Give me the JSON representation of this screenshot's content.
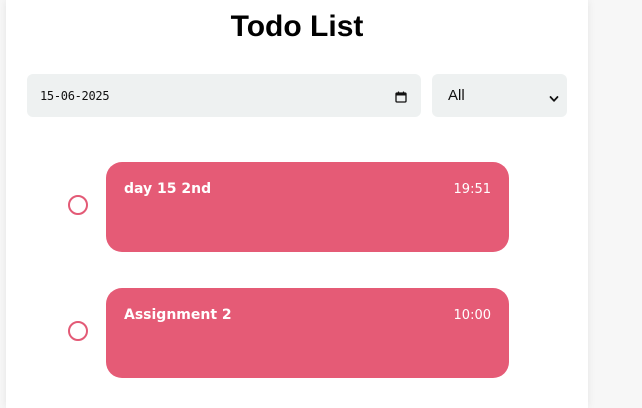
{
  "header": {
    "title": "Todo List"
  },
  "filters": {
    "date_value": "15-06-2025",
    "status_selected": "All"
  },
  "todos": [
    {
      "title": "day 15 2nd",
      "time": "19:51",
      "completed": false
    },
    {
      "title": "Assignment 2",
      "time": "10:00",
      "completed": false
    }
  ],
  "colors": {
    "card": "#e55b76",
    "check_border": "#e35a76",
    "field_background": "#eef1f1"
  },
  "icons": {
    "date": "calendar-icon",
    "select": "chevron-down-icon",
    "todo_check": "circle-icon"
  }
}
